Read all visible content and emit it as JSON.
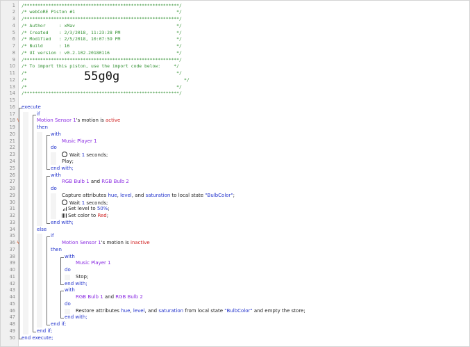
{
  "editor": {
    "lines": [
      {
        "n": "1",
        "text": "/**********************************************************/"
      },
      {
        "n": "2",
        "text": "/* webCoRE Piston #1                                      */"
      },
      {
        "n": "3",
        "text": "/**********************************************************/"
      },
      {
        "n": "4",
        "text": "/* Author     : xMav                                      */"
      },
      {
        "n": "5",
        "text": "/* Created    : 2/3/2018, 11:23:28 PM                     */"
      },
      {
        "n": "6",
        "text": "/* Modified   : 2/5/2018, 10:07:59 PM                     */"
      },
      {
        "n": "7",
        "text": "/* Build      : 16                                        */"
      },
      {
        "n": "8",
        "text": "/* UI version : v0.2.102.20180116                         */"
      },
      {
        "n": "9",
        "text": "/**********************************************************/"
      },
      {
        "n": "10",
        "text": "/* To import this piston, use the import code below:     */"
      },
      {
        "n": "11",
        "text": "/*                                                        */"
      },
      {
        "n": "12",
        "text": "/*"
      },
      {
        "n": "13",
        "text": "/*                                                        */"
      },
      {
        "n": "14",
        "text": "/**********************************************************/"
      },
      {
        "n": "15",
        "text": ""
      },
      {
        "n": "16",
        "text": "execute"
      },
      {
        "n": "17",
        "text": "if"
      },
      {
        "n": "18",
        "text": "Motion Sensor 1's motion is active"
      },
      {
        "n": "19",
        "text": "then"
      },
      {
        "n": "20",
        "text": "with"
      },
      {
        "n": "21",
        "text": "Music Player 1"
      },
      {
        "n": "22",
        "text": "do"
      },
      {
        "n": "23",
        "text": "Wait 1 seconds;"
      },
      {
        "n": "24",
        "text": "Play;"
      },
      {
        "n": "25",
        "text": "end with;"
      },
      {
        "n": "26",
        "text": "with"
      },
      {
        "n": "27",
        "text": "RGB Bulb 1 and RGB Bulb 2"
      },
      {
        "n": "28",
        "text": "do"
      },
      {
        "n": "29",
        "text": "Capture attributes hue, level, and saturation to local state \"BulbColor\";"
      },
      {
        "n": "30",
        "text": "Wait 1 seconds;"
      },
      {
        "n": "31",
        "text": "Set level to 50%;"
      },
      {
        "n": "32",
        "text": "Set color to Red;"
      },
      {
        "n": "33",
        "text": "end with;"
      },
      {
        "n": "34",
        "text": "else"
      },
      {
        "n": "35",
        "text": "if"
      },
      {
        "n": "36",
        "text": "Motion Sensor 1's motion is inactive"
      },
      {
        "n": "37",
        "text": "then"
      },
      {
        "n": "38",
        "text": "with"
      },
      {
        "n": "39",
        "text": "Music Player 1"
      },
      {
        "n": "40",
        "text": "do"
      },
      {
        "n": "41",
        "text": "Stop;"
      },
      {
        "n": "42",
        "text": "end with;"
      },
      {
        "n": "43",
        "text": "with"
      },
      {
        "n": "44",
        "text": "RGB Bulb 1 and RGB Bulb 2"
      },
      {
        "n": "45",
        "text": "do"
      },
      {
        "n": "46",
        "text": "Restore attributes hue, level, and saturation from local state \"BulbColor\" and empty the store;"
      },
      {
        "n": "47",
        "text": "end with;"
      },
      {
        "n": "48",
        "text": "end if;"
      },
      {
        "n": "49",
        "text": "end if;"
      },
      {
        "n": "50",
        "text": "end execute;"
      }
    ],
    "import_code": "55g0g",
    "import_code_tail": "*/",
    "highlight_color": "#d02020",
    "keyword_color": "#2233cc",
    "device_color": "#8a2be2",
    "comment_color": "#2f8f2f"
  }
}
